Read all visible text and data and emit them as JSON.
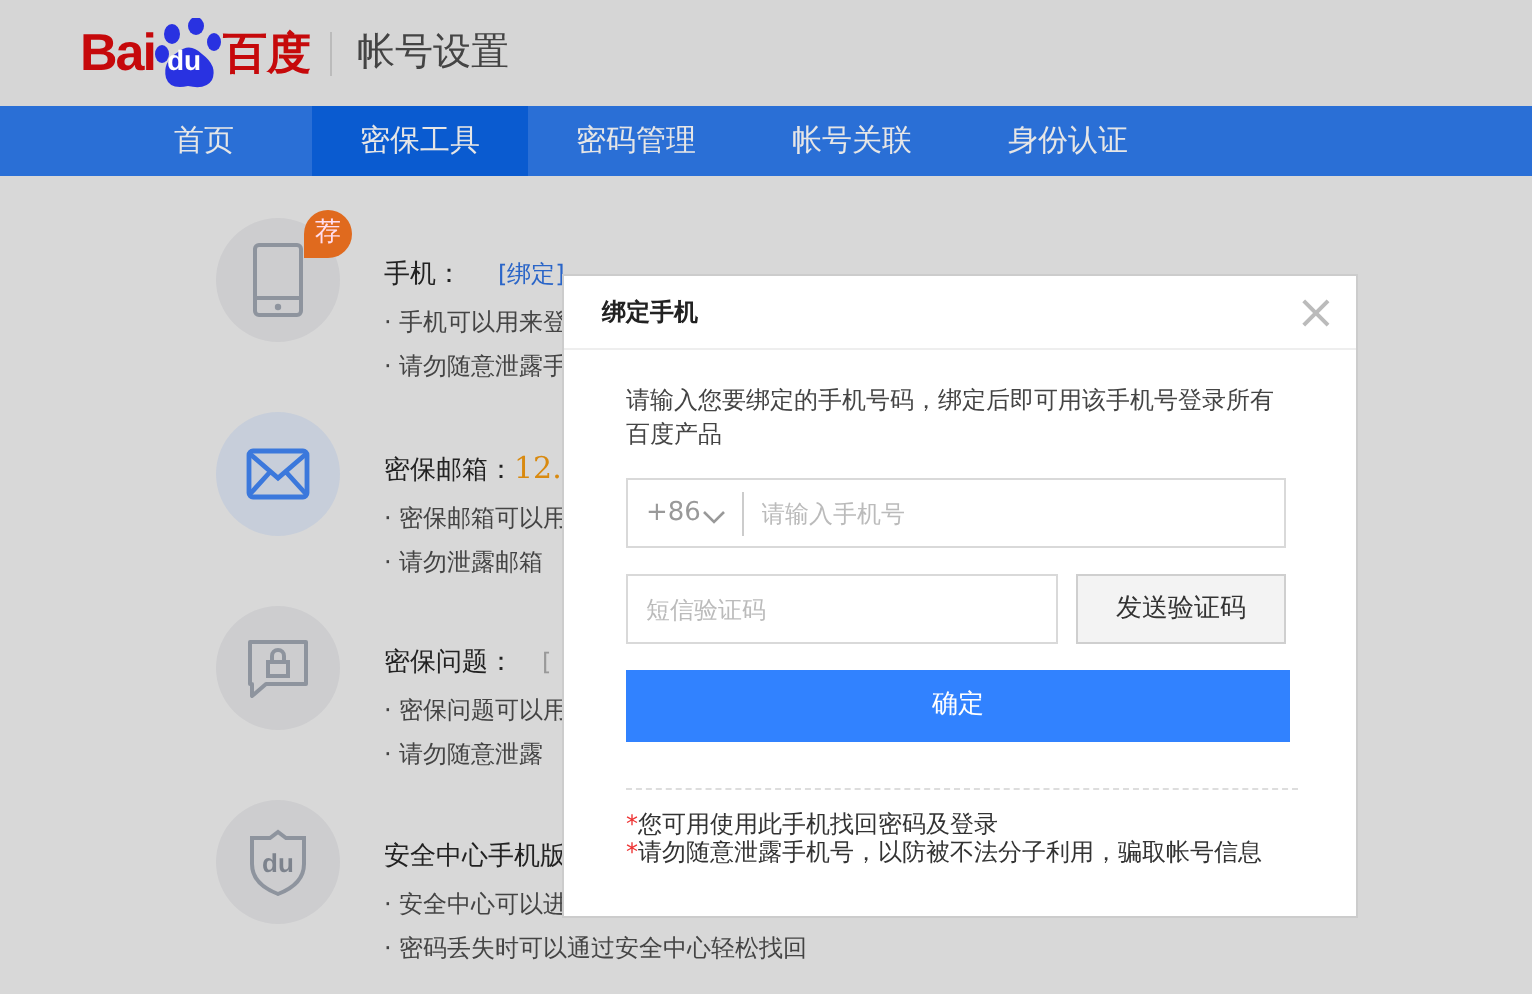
{
  "header": {
    "logo": {
      "left": "Bai",
      "paw": "du",
      "right": "百度"
    },
    "title": "帐号设置"
  },
  "nav": [
    {
      "label": "首页",
      "selected": false
    },
    {
      "label": "密保工具",
      "selected": true
    },
    {
      "label": "密码管理",
      "selected": false
    },
    {
      "label": "帐号关联",
      "selected": false
    },
    {
      "label": "身份认证",
      "selected": false
    }
  ],
  "items": [
    {
      "kind": "phone",
      "highlighted": false,
      "badge": "荐",
      "title": "手机：",
      "value": {
        "text": "[绑定]",
        "kind": "link"
      },
      "notes": [
        "· 手机可以用来登",
        "· 请勿随意泄露手"
      ]
    },
    {
      "kind": "mail",
      "highlighted": true,
      "title": "密保邮箱：",
      "value": {
        "text": "12.",
        "kind": "highlight"
      },
      "notes": [
        "· 密保邮箱可以用",
        "· 请勿泄露邮箱"
      ]
    },
    {
      "kind": "lock",
      "highlighted": false,
      "title": "密保问题：",
      "value": {
        "text": "[",
        "kind": "muted"
      },
      "notes": [
        "· 密保问题可以用",
        "· 请勿随意泄露"
      ]
    },
    {
      "kind": "shield",
      "icon_text": "du",
      "highlighted": false,
      "title": "安全中心手机版",
      "notes": [
        "· 安全中心可以进",
        "· 密码丢失时可以通过安全中心轻松找回"
      ]
    }
  ],
  "modal": {
    "title": "绑定手机",
    "close": "×",
    "intro": "请输入您要绑定的手机号码，绑定后即可用该手机号登录所有百度产品",
    "country_code": "+86",
    "phone_placeholder": "请输入手机号",
    "code_placeholder": "短信验证码",
    "send_button": "发送验证码",
    "confirm_button": "确定",
    "notes": [
      {
        "mark": "*",
        "text": "您可用使用此手机找回密码及登录"
      },
      {
        "mark": "*",
        "text": "请勿随意泄露手机号，以防被不法分子利用，骗取帐号信息"
      }
    ]
  }
}
